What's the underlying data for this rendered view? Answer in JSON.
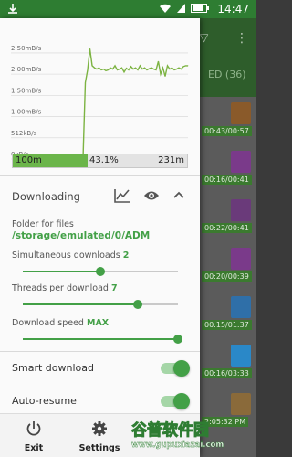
{
  "status_bar": {
    "clock": "14:47",
    "icons": [
      "notification-icon",
      "wifi-icon",
      "signal-icon",
      "battery-icon"
    ]
  },
  "background": {
    "tab_label": "ED (36)",
    "rows": [
      {
        "time": "00:43/00:57",
        "thumb": "#8a5a2a"
      },
      {
        "time": "00:16/00:41",
        "thumb": "#7a3a8a"
      },
      {
        "time": "00:22/00:41",
        "thumb": "#6a3a7a"
      },
      {
        "time": "00:20/00:39",
        "thumb": "#7a3a8a"
      },
      {
        "time": "00:15/01:37",
        "thumb": "#2f6fa8"
      },
      {
        "time": "00:16/03:33",
        "thumb": "#2a88c8"
      },
      {
        "time": "2:05:32 PM",
        "thumb": "#8a6a3a"
      }
    ]
  },
  "chart_data": {
    "type": "line",
    "ylabel": "",
    "ytick_labels": [
      "2.50mB/s",
      "2.00mB/s",
      "1.50mB/s",
      "1.00mB/s",
      "512kB/s",
      "0kB/s"
    ],
    "ytick_values": [
      2.5,
      2.0,
      1.5,
      1.0,
      0.5,
      0.0
    ],
    "ylim": [
      0,
      2.8
    ],
    "xlim": [
      0,
      60
    ],
    "grid": true,
    "series": [
      {
        "color": "#7cb342",
        "x": [
          0,
          4,
          8,
          12,
          14,
          15,
          16,
          17,
          18,
          19,
          20,
          21,
          22,
          23,
          24,
          25,
          26,
          27,
          28,
          29,
          30,
          31,
          32,
          33,
          34,
          35,
          36,
          37,
          38,
          39,
          40,
          41,
          42,
          43,
          44,
          45,
          46,
          47,
          48,
          49,
          50,
          51,
          52,
          53,
          54,
          55,
          56,
          57,
          58,
          59,
          60
        ],
        "y": [
          0,
          0,
          0,
          0,
          0.02,
          1.8,
          2.1,
          2.6,
          2.2,
          2.15,
          2.12,
          2.15,
          2.1,
          2.12,
          2.08,
          2.1,
          2.15,
          2.12,
          2.2,
          2.1,
          2.12,
          2.15,
          2.05,
          2.14,
          2.1,
          2.18,
          2.12,
          2.15,
          2.1,
          2.2,
          2.12,
          2.15,
          2.1,
          2.13,
          2.15,
          2.12,
          2.1,
          2.3,
          2.0,
          2.15,
          1.95,
          2.2,
          2.12,
          2.15,
          2.1,
          2.12,
          2.15,
          2.12,
          2.18,
          2.2,
          2.2
        ]
      }
    ]
  },
  "progress": {
    "downloaded": "100m",
    "percent_label": "43.1%",
    "percent": 43.1,
    "total": "231m"
  },
  "downloading": {
    "title": "Downloading",
    "icons": [
      "line-chart-icon",
      "eye-icon",
      "chevron-up-icon"
    ]
  },
  "folder": {
    "label": "Folder for files",
    "path": "/storage/emulated/0/ADM"
  },
  "simultaneous": {
    "label": "Simultaneous downloads",
    "value": "2",
    "level": 0.5
  },
  "threads": {
    "label": "Threads per download",
    "value": "7",
    "level": 0.74
  },
  "speed": {
    "label": "Download speed",
    "value": "MAX",
    "level": 1.0
  },
  "toggles": [
    {
      "label": "Smart download",
      "on": true
    },
    {
      "label": "Auto-resume",
      "on": true
    }
  ],
  "bottom_bar": {
    "exit_label": "Exit",
    "settings_label": "Settings"
  },
  "watermark": {
    "cn": "谷普软件园",
    "url": "www.gupuxiazai.com"
  },
  "colors": {
    "accent": "#43a047",
    "status_bar": "#2e7d32",
    "chart_line": "#7cb342",
    "progress_fill": "#6bb54a"
  }
}
